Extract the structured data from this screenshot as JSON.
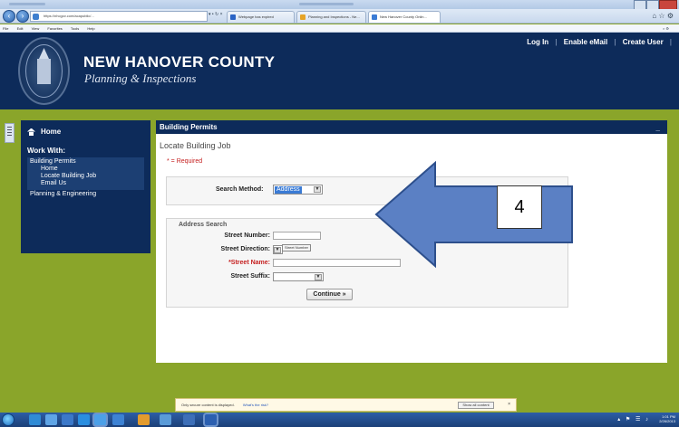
{
  "browser": {
    "url": "https://nhcgov.com/acapublic/...",
    "address_controls": "▾ • ↻ ×",
    "tabs": [
      {
        "label": "Webpage has expired",
        "color": "#2a64c5"
      },
      {
        "label": "Planning and Inspections - Ne...",
        "color": "#e6a427"
      },
      {
        "label": "New Hanover County Onlin...",
        "color": "#3a7bd5"
      }
    ],
    "menu": [
      "File",
      "Edit",
      "View",
      "Favorites",
      "Tools",
      "Help"
    ]
  },
  "site": {
    "title": "NEW HANOVER COUNTY",
    "subtitle": "Planning & Inspections",
    "top_links": [
      "Log In",
      "Enable eMail",
      "Create User"
    ],
    "top_link_separator": "|"
  },
  "sidebar": {
    "home": "Home",
    "work_with": "Work With:",
    "active_group": "Building Permits",
    "sub_items": [
      "Home",
      "Locate Building Job",
      "Email Us"
    ],
    "other_item": "Planning & Engineering"
  },
  "main": {
    "header": "Building Permits",
    "header_right": "_",
    "title": "Locate Building Job",
    "required_note": "* = Required",
    "search_method_label": "Search Method:",
    "search_method_value": "Address",
    "address_legend": "Address Search",
    "fields": {
      "street_number": "Street Number:",
      "street_direction": "Street Direction:",
      "street_name": "*Street Name:",
      "street_suffix": "Street Suffix:"
    },
    "tooltip": "Street Number",
    "continue_label": "Continue »"
  },
  "annotation": {
    "callout_number": "4",
    "arrow_color": "#5b80c4",
    "arrow_border": "#2d4f8c"
  },
  "notification": {
    "text": "Only secure content is displayed.",
    "link": "What's the risk?",
    "button": "Show all content",
    "close": "×"
  },
  "taskbar": {
    "time": "1:01 PM",
    "date": "2/26/2013",
    "tray": "▴ ⚑ ☰ ♪"
  },
  "colors": {
    "navy": "#0d2b5a",
    "page_bg": "#8aa52a",
    "required": "#c52020"
  }
}
